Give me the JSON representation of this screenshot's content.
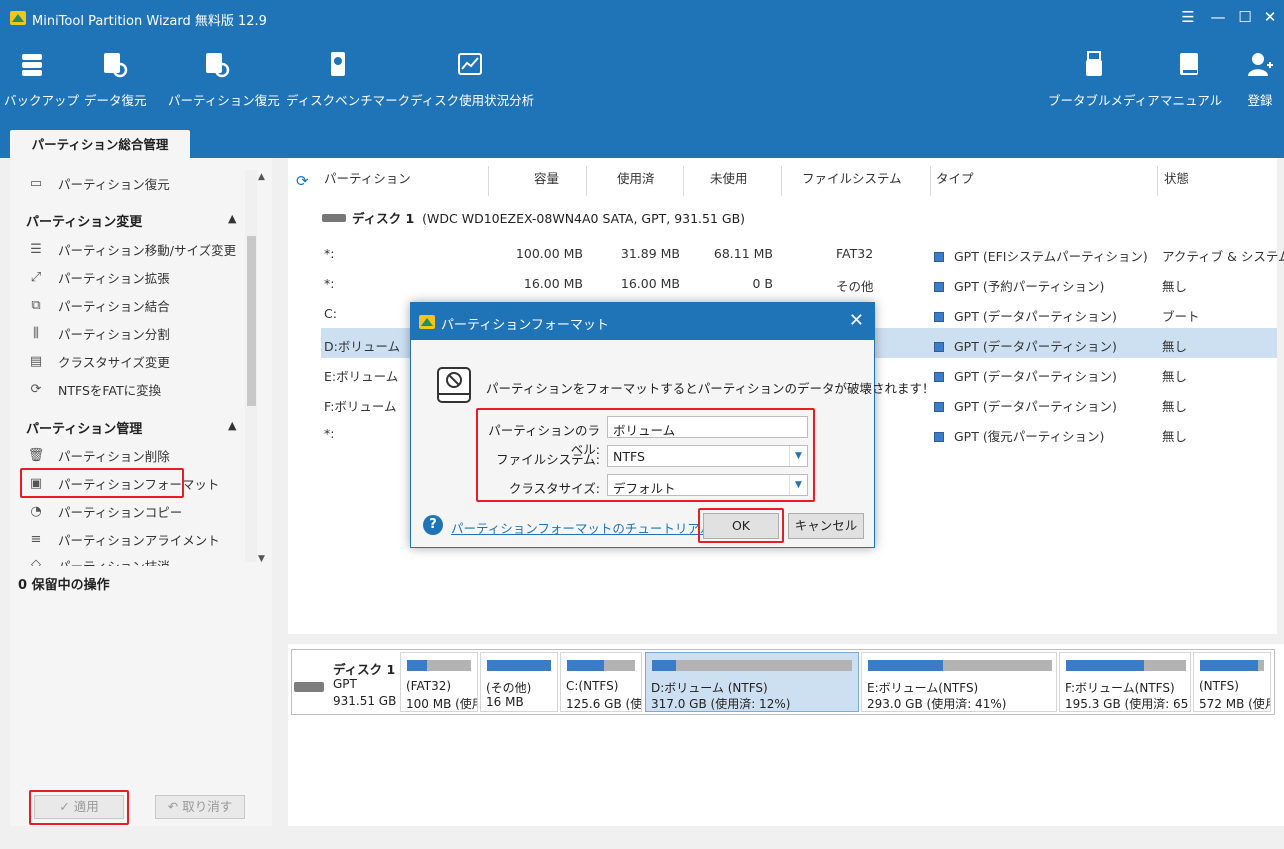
{
  "app": {
    "title": "MiniTool Partition Wizard 無料版 12.9"
  },
  "toolbar": {
    "backup": "バックアップ",
    "data_recovery": "データ復元",
    "partition_recovery": "パーティション復元",
    "disk_benchmark": "ディスクベンチマーク",
    "disk_usage": "ディスク使用状況分析",
    "bootable_media": "ブータブルメディア",
    "manual": "マニュアル",
    "register": "登録"
  },
  "tab": {
    "main": "パーティション総合管理"
  },
  "sidebar": {
    "partition_recovery": "パーティション復元",
    "section_change": "パーティション変更",
    "move_resize": "パーティション移動/サイズ変更",
    "extend": "パーティション拡張",
    "merge": "パーティション結合",
    "split": "パーティション分割",
    "cluster_size": "クラスタサイズ変更",
    "ntfs_to_fat": "NTFSをFATに変換",
    "section_manage": "パーティション管理",
    "delete": "パーティション削除",
    "format": "パーティションフォーマット",
    "copy": "パーティションコピー",
    "align": "パーティションアライメント",
    "wipe": "パーティション抹消",
    "pending": "0 保留中の操作",
    "apply": "✓ 適用",
    "undo": "↶ 取り消す"
  },
  "table": {
    "headers": [
      "パーティション",
      "容量",
      "使用済",
      "未使用",
      "ファイルシステム",
      "タイプ",
      "状態"
    ],
    "disk_label": "ディスク 1",
    "disk_info": "(WDC WD10EZEX-08WN4A0 SATA, GPT, 931.51 GB)",
    "rows": [
      {
        "name": "*:",
        "capacity": "100.00 MB",
        "used": "31.89 MB",
        "unused": "68.11 MB",
        "fs": "FAT32",
        "type": "GPT (EFIシステムパーティション)",
        "status": "アクティブ & システム"
      },
      {
        "name": "*:",
        "capacity": "16.00 MB",
        "used": "16.00 MB",
        "unused": "0 B",
        "fs": "その他",
        "type": "GPT (予約パーティション)",
        "status": "無し"
      },
      {
        "name": "C:",
        "capacity": "",
        "used": "",
        "unused": "",
        "fs": "",
        "type": "GPT (データパーティション)",
        "status": "ブート"
      },
      {
        "name": "D:ボリューム",
        "capacity": "",
        "used": "",
        "unused": "",
        "fs": "",
        "type": "GPT (データパーティション)",
        "status": "無し"
      },
      {
        "name": "E:ボリューム",
        "capacity": "",
        "used": "",
        "unused": "",
        "fs": "",
        "type": "GPT (データパーティション)",
        "status": "無し"
      },
      {
        "name": "F:ボリューム",
        "capacity": "",
        "used": "",
        "unused": "",
        "fs": "",
        "type": "GPT (データパーティション)",
        "status": "無し"
      },
      {
        "name": "*:",
        "capacity": "",
        "used": "",
        "unused": "",
        "fs": "",
        "type": "GPT (復元パーティション)",
        "status": "無し"
      }
    ]
  },
  "diskmap": {
    "disk_name": "ディスク 1",
    "disk_type": "GPT",
    "disk_size": "931.51 GB",
    "parts": [
      {
        "l1": "(FAT32)",
        "l2": "100 MB (使用",
        "fill": 0.32
      },
      {
        "l1": "(その他)",
        "l2": "16 MB",
        "fill": 1.0
      },
      {
        "l1": "C:(NTFS)",
        "l2": "125.6 GB (使用",
        "fill": 0.55
      },
      {
        "l1": "D:ボリューム (NTFS)",
        "l2": "317.0 GB (使用済: 12%)",
        "fill": 0.12
      },
      {
        "l1": "E:ボリューム(NTFS)",
        "l2": "293.0 GB (使用済: 41%)",
        "fill": 0.41
      },
      {
        "l1": "F:ボリューム(NTFS)",
        "l2": "195.3 GB (使用済: 65",
        "fill": 0.65
      },
      {
        "l1": "(NTFS)",
        "l2": "572 MB (使月",
        "fill": 0.9
      }
    ]
  },
  "dialog": {
    "title": "パーティションフォーマット",
    "warning": "パーティションをフォーマットするとパーティションのデータが破壊されます！",
    "label_lbl": "パーティションのラベル:",
    "label_val": "ボリューム",
    "fs_lbl": "ファイルシステム:",
    "fs_val": "NTFS",
    "cluster_lbl": "クラスタサイズ:",
    "cluster_val": "デフォルト",
    "tutorial_link": "パーティションフォーマットのチュートリアル",
    "ok": "OK",
    "cancel": "キャンセル"
  }
}
